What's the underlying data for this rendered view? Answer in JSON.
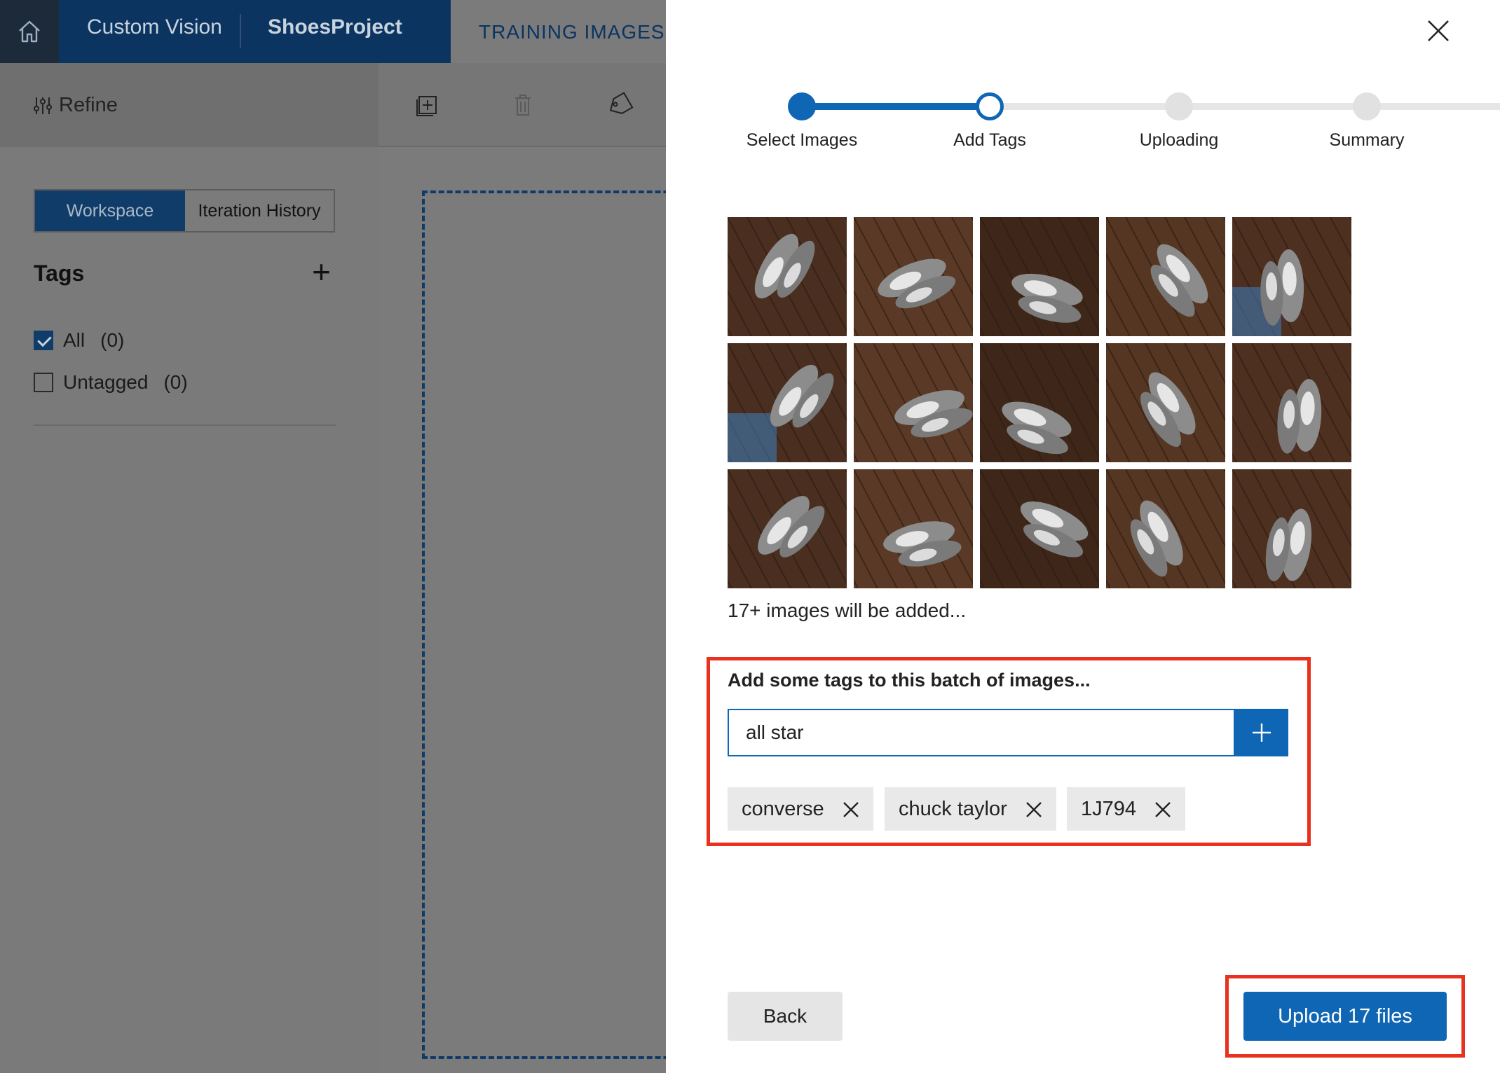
{
  "header": {
    "app_name": "Custom Vision",
    "project_name": "ShoesProject",
    "active_tab": "TRAINING IMAGES"
  },
  "sidebar": {
    "refine_label": "Refine",
    "view_toggle": {
      "active": "Workspace",
      "inactive": "Iteration History"
    },
    "tags_heading": "Tags",
    "filters": [
      {
        "label": "All",
        "count": "(0)",
        "checked": true
      },
      {
        "label": "Untagged",
        "count": "(0)",
        "checked": false
      }
    ]
  },
  "dialog": {
    "steps": [
      {
        "label": "Select Images",
        "state": "done"
      },
      {
        "label": "Add Tags",
        "state": "current"
      },
      {
        "label": "Uploading",
        "state": "todo"
      },
      {
        "label": "Summary",
        "state": "todo"
      }
    ],
    "images_note": "17+ images will be added...",
    "tag_section_title": "Add some tags to this batch of images...",
    "tag_input_value": "all star",
    "tags": [
      "converse",
      "chuck taylor",
      "1J794"
    ],
    "back_label": "Back",
    "upload_label": "Upload 17 files"
  },
  "colors": {
    "accent": "#0f66b4",
    "header": "#0c3461",
    "highlight": "#e8321f"
  }
}
